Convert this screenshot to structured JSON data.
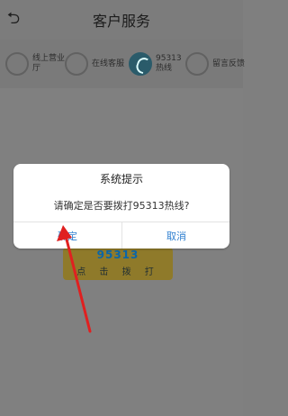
{
  "header": {
    "title": "客户服务",
    "back_icon": "back-arrow-icon"
  },
  "tabs": [
    {
      "label": "线上营业厅",
      "icon": "online-hall-icon"
    },
    {
      "label": "在线客服",
      "icon": "chat-icon"
    },
    {
      "label": "95313热线",
      "icon": "phone-icon",
      "active": true
    },
    {
      "label": "留言反馈",
      "icon": "feedback-icon"
    }
  ],
  "banner": {
    "call_text": "点 击 拨 打"
  },
  "dialog": {
    "title": "系统提示",
    "message": "请确定是否要拨打95313热线?",
    "confirm": "确定",
    "cancel": "取消"
  },
  "colors": {
    "link": "#2f7fd0",
    "overlay": "#7f7f7f",
    "annotation": "#e02020"
  }
}
